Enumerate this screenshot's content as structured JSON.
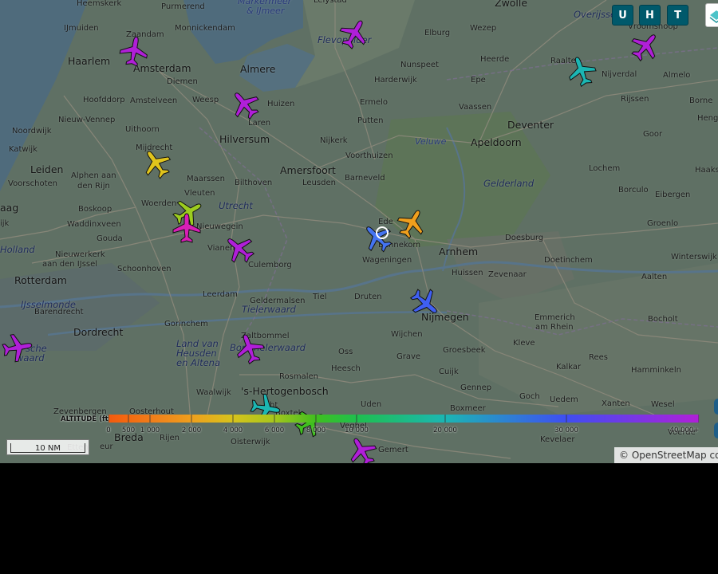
{
  "header_buttons": [
    {
      "label": "U"
    },
    {
      "label": "H"
    },
    {
      "label": "T"
    }
  ],
  "scale_label": "10 NM",
  "attribution": "© OpenStreetMap cor",
  "altitude_legend": {
    "title": "ALTITUDE (ft)",
    "stops": [
      {
        "label": "0",
        "color": "#f25a0e"
      },
      {
        "label": "500",
        "color": "#f46a10"
      },
      {
        "label": "1 000",
        "color": "#f07c1a"
      },
      {
        "label": "2 000",
        "color": "#ef9f1d"
      },
      {
        "label": "4 000",
        "color": "#d6c31c"
      },
      {
        "label": "6 000",
        "color": "#a6c61c"
      },
      {
        "label": "8 000",
        "color": "#3fbf1f"
      },
      {
        "label": "10 000",
        "color": "#1fbf4e"
      },
      {
        "label": "20 000",
        "color": "#1bb6b3"
      },
      {
        "label": "30 000",
        "color": "#3f4ef2"
      },
      {
        "label": "40 000+",
        "color": "#b01fd8"
      }
    ]
  },
  "places": [
    {
      "name": "Heemskerk",
      "cls": "small"
    },
    {
      "name": "Purmerend",
      "cls": "small"
    },
    {
      "name": "Markermeer",
      "cls": "water"
    },
    {
      "name": "& IJmeer",
      "cls": "water"
    },
    {
      "name": "Lelystad",
      "cls": "small"
    },
    {
      "name": "Zwolle",
      "cls": "city"
    },
    {
      "name": "Overijssel",
      "cls": "region"
    },
    {
      "name": "IJmuiden",
      "cls": "small"
    },
    {
      "name": "Zaandam",
      "cls": "small"
    },
    {
      "name": "Monnickendam",
      "cls": "small"
    },
    {
      "name": "Flevopolder",
      "cls": "region"
    },
    {
      "name": "Elburg",
      "cls": "small"
    },
    {
      "name": "Wezep",
      "cls": "small"
    },
    {
      "name": "Vroomshoop",
      "cls": "small"
    },
    {
      "name": "Haarlem",
      "cls": "city"
    },
    {
      "name": "Amsterdam",
      "cls": "city"
    },
    {
      "name": "Almere",
      "cls": "city"
    },
    {
      "name": "Nunspeet",
      "cls": "small"
    },
    {
      "name": "Heerde",
      "cls": "small"
    },
    {
      "name": "Raalte",
      "cls": "small"
    },
    {
      "name": "Nijverdal",
      "cls": "small"
    },
    {
      "name": "Almelo",
      "cls": "small"
    },
    {
      "name": "Diemen",
      "cls": "small"
    },
    {
      "name": "Harderwijk",
      "cls": "small"
    },
    {
      "name": "Epe",
      "cls": "small"
    },
    {
      "name": "Hoofddorp",
      "cls": "small"
    },
    {
      "name": "Amstelveen",
      "cls": "small"
    },
    {
      "name": "Weesp",
      "cls": "small"
    },
    {
      "name": "Huizen",
      "cls": "small"
    },
    {
      "name": "Ermelo",
      "cls": "small"
    },
    {
      "name": "Vaassen",
      "cls": "small"
    },
    {
      "name": "Rijssen",
      "cls": "small"
    },
    {
      "name": "Borne",
      "cls": "small"
    },
    {
      "name": "Nieuw-Vennep",
      "cls": "small"
    },
    {
      "name": "Laren",
      "cls": "small"
    },
    {
      "name": "Putten",
      "cls": "small"
    },
    {
      "name": "Deventer",
      "cls": "city"
    },
    {
      "name": "Heng",
      "cls": "small"
    },
    {
      "name": "Noordwijk",
      "cls": "small"
    },
    {
      "name": "Uithoorn",
      "cls": "small"
    },
    {
      "name": "Hilversum",
      "cls": "city"
    },
    {
      "name": "Nijkerk",
      "cls": "small"
    },
    {
      "name": "Veluwe",
      "cls": "water"
    },
    {
      "name": "Apeldoorn",
      "cls": "city"
    },
    {
      "name": "Goor",
      "cls": "small"
    },
    {
      "name": "Katwijk",
      "cls": "small"
    },
    {
      "name": "Mijdrecht",
      "cls": "small"
    },
    {
      "name": "Voorthuizen",
      "cls": "small"
    },
    {
      "name": "Leiden",
      "cls": "city"
    },
    {
      "name": "Amersfoort",
      "cls": "city"
    },
    {
      "name": "Lochem",
      "cls": "small"
    },
    {
      "name": "Haaksberge",
      "cls": "small"
    },
    {
      "name": "Alphen aan",
      "cls": "small"
    },
    {
      "name": "den Rijn",
      "cls": "small"
    },
    {
      "name": "Maarssen",
      "cls": "small"
    },
    {
      "name": "Barneveld",
      "cls": "small"
    },
    {
      "name": "Voorschoten",
      "cls": "small"
    },
    {
      "name": "Bilthoven",
      "cls": "small"
    },
    {
      "name": "Leusden",
      "cls": "small"
    },
    {
      "name": "Gelderland",
      "cls": "region"
    },
    {
      "name": "Borculo",
      "cls": "small"
    },
    {
      "name": "Vleuten",
      "cls": "small"
    },
    {
      "name": "Eibergen",
      "cls": "small"
    },
    {
      "name": "aag",
      "cls": "city"
    },
    {
      "name": "Boskoop",
      "cls": "small"
    },
    {
      "name": "Woerden",
      "cls": "small"
    },
    {
      "name": "Utrecht",
      "cls": "region"
    },
    {
      "name": "Ede",
      "cls": "small"
    },
    {
      "name": "Waddinxveen",
      "cls": "small"
    },
    {
      "name": "Nieuwegein",
      "cls": "small"
    },
    {
      "name": "Groenlo",
      "cls": "small"
    },
    {
      "name": "ijk",
      "cls": "small"
    },
    {
      "name": "Gouda",
      "cls": "small"
    },
    {
      "name": "Bennekom",
      "cls": "small"
    },
    {
      "name": "Doesburg",
      "cls": "small"
    },
    {
      "name": "Holland",
      "cls": "region"
    },
    {
      "name": "Vianen",
      "cls": "small"
    },
    {
      "name": "Arnhem",
      "cls": "city"
    },
    {
      "name": "Winterswijk",
      "cls": "small"
    },
    {
      "name": "Nieuwerkerk",
      "cls": "small"
    },
    {
      "name": "aan den IJssel",
      "cls": "small"
    },
    {
      "name": "Wageningen",
      "cls": "small"
    },
    {
      "name": "Doetinchem",
      "cls": "small"
    },
    {
      "name": "Culemborg",
      "cls": "small"
    },
    {
      "name": "Schoonhoven",
      "cls": "small"
    },
    {
      "name": "Huissen",
      "cls": "small"
    },
    {
      "name": "Zevenaar",
      "cls": "small"
    },
    {
      "name": "Rotterdam",
      "cls": "city"
    },
    {
      "name": "Aalten",
      "cls": "small"
    },
    {
      "name": "Leerdam",
      "cls": "small"
    },
    {
      "name": "Tiel",
      "cls": "small"
    },
    {
      "name": "Druten",
      "cls": "small"
    },
    {
      "name": "Geldermalsen",
      "cls": "small"
    },
    {
      "name": "IJsselmonde",
      "cls": "region"
    },
    {
      "name": "Tielerwaard",
      "cls": "region"
    },
    {
      "name": "Barendrecht",
      "cls": "small"
    },
    {
      "name": "Nijmegen",
      "cls": "city"
    },
    {
      "name": "Emmerich",
      "cls": "small"
    },
    {
      "name": "am Rhein",
      "cls": "small"
    },
    {
      "name": "Bocholt",
      "cls": "small"
    },
    {
      "name": "Dordrecht",
      "cls": "city"
    },
    {
      "name": "Gorinchem",
      "cls": "small"
    },
    {
      "name": "Wijchen",
      "cls": "small"
    },
    {
      "name": "Zaltbommel",
      "cls": "small"
    },
    {
      "name": "Kleve",
      "cls": "small"
    },
    {
      "name": "Land van",
      "cls": "region"
    },
    {
      "name": "Heusden",
      "cls": "region"
    },
    {
      "name": "en Altena",
      "cls": "region"
    },
    {
      "name": "Bommelerwaard",
      "cls": "region"
    },
    {
      "name": "sche",
      "cls": "region"
    },
    {
      "name": "waard",
      "cls": "region"
    },
    {
      "name": "Oss",
      "cls": "small"
    },
    {
      "name": "Grave",
      "cls": "small"
    },
    {
      "name": "Groesbeek",
      "cls": "small"
    },
    {
      "name": "Rees",
      "cls": "small"
    },
    {
      "name": "Heesch",
      "cls": "small"
    },
    {
      "name": "Cuijk",
      "cls": "small"
    },
    {
      "name": "Rosmalen",
      "cls": "small"
    },
    {
      "name": "Kalkar",
      "cls": "small"
    },
    {
      "name": "Hamminkeln",
      "cls": "small"
    },
    {
      "name": "Gennep",
      "cls": "small"
    },
    {
      "name": "Waalwijk",
      "cls": "small"
    },
    {
      "name": "'s-Hertogenbosch",
      "cls": "city"
    },
    {
      "name": "Goch",
      "cls": "small"
    },
    {
      "name": "Uedem",
      "cls": "small"
    },
    {
      "name": "Uden",
      "cls": "small"
    },
    {
      "name": "Boxmeer",
      "cls": "small"
    },
    {
      "name": "Xanten",
      "cls": "small"
    },
    {
      "name": "Wesel",
      "cls": "small"
    },
    {
      "name": "Zevenbergen",
      "cls": "small"
    },
    {
      "name": "Oosterhout",
      "cls": "small"
    },
    {
      "name": "Boxtel",
      "cls": "small"
    },
    {
      "name": "Breda",
      "cls": "city"
    },
    {
      "name": "Rijen",
      "cls": "small"
    },
    {
      "name": "Oisterwijk",
      "cls": "small"
    },
    {
      "name": "Veghel",
      "cls": "small"
    },
    {
      "name": "Gemert",
      "cls": "small"
    },
    {
      "name": "Kevelaer",
      "cls": "small"
    },
    {
      "name": "Voerde",
      "cls": "small"
    },
    {
      "name": "Etten",
      "cls": "small"
    },
    {
      "name": "eur",
      "cls": "small"
    },
    {
      "name": "ht",
      "cls": "small"
    }
  ],
  "aircraft": [
    {
      "id": "ac-1",
      "color": "#b01fd8",
      "rot": 30
    },
    {
      "id": "ac-2",
      "color": "#b01fd8",
      "rot": 10
    },
    {
      "id": "ac-3",
      "color": "#1bb6b3",
      "rot": -20
    },
    {
      "id": "ac-4",
      "color": "#b01fd8",
      "rot": 40
    },
    {
      "id": "ac-5",
      "color": "#b01fd8",
      "rot": -40
    },
    {
      "id": "ac-6",
      "color": "#e0c41c",
      "rot": -35
    },
    {
      "id": "ac-7",
      "color": "#9ccc1f",
      "rot": 60
    },
    {
      "id": "ac-8",
      "color": "#d81fb6",
      "rot": 0
    },
    {
      "id": "ac-9",
      "color": "#b01fd8",
      "rot": -50
    },
    {
      "id": "ac-10",
      "color": "#4474f0",
      "rot": -45
    },
    {
      "id": "ac-11",
      "color": "#ef9f1d",
      "rot": 30
    },
    {
      "id": "ac-12",
      "color": "#3f5ff2",
      "rot": 130
    },
    {
      "id": "ac-13",
      "color": "#b01fd8",
      "rot": 80
    },
    {
      "id": "ac-14",
      "color": "#b01fd8",
      "rot": -20
    },
    {
      "id": "ac-15",
      "color": "#1bb6b3",
      "rot": 100
    },
    {
      "id": "ac-16",
      "color": "#3fbf1f",
      "rot": 60
    },
    {
      "id": "ac-17",
      "color": "#b01fd8",
      "rot": -30
    }
  ]
}
